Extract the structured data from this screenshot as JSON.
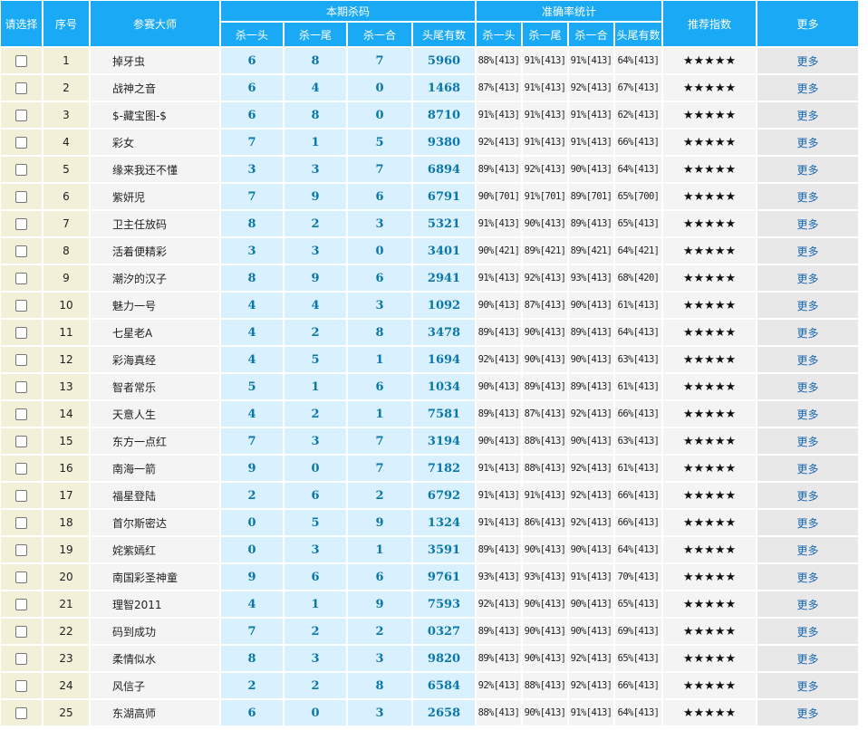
{
  "header": {
    "select": "请选择",
    "no": "序号",
    "master": "参赛大师",
    "kill_group": "本期杀码",
    "acc_group": "准确率统计",
    "recommend": "推荐指数",
    "more": "更多",
    "sub": [
      "杀一头",
      "杀一尾",
      "杀一合",
      "头尾有数",
      "杀一头",
      "杀一尾",
      "杀一合",
      "头尾有数"
    ]
  },
  "rating_stars": 5,
  "more_label": "更多",
  "rows": [
    {
      "no": "1",
      "name": "掉牙虫",
      "k": [
        "6",
        "8",
        "7",
        "5960"
      ],
      "a": [
        "88%[413]",
        "91%[413]",
        "91%[413]",
        "64%[413]"
      ]
    },
    {
      "no": "2",
      "name": "战神之音",
      "k": [
        "6",
        "4",
        "0",
        "1468"
      ],
      "a": [
        "87%[413]",
        "91%[413]",
        "92%[413]",
        "67%[413]"
      ]
    },
    {
      "no": "3",
      "name": "$-藏宝图-$",
      "k": [
        "6",
        "8",
        "0",
        "8710"
      ],
      "a": [
        "91%[413]",
        "91%[413]",
        "91%[413]",
        "62%[413]"
      ]
    },
    {
      "no": "4",
      "name": "彩女",
      "k": [
        "7",
        "1",
        "5",
        "9380"
      ],
      "a": [
        "92%[413]",
        "91%[413]",
        "91%[413]",
        "66%[413]"
      ]
    },
    {
      "no": "5",
      "name": "缘来我还不懂",
      "k": [
        "3",
        "3",
        "7",
        "6894"
      ],
      "a": [
        "89%[413]",
        "92%[413]",
        "90%[413]",
        "64%[413]"
      ]
    },
    {
      "no": "6",
      "name": "紫妍児",
      "k": [
        "7",
        "9",
        "6",
        "6791"
      ],
      "a": [
        "90%[701]",
        "91%[701]",
        "89%[701]",
        "65%[700]"
      ]
    },
    {
      "no": "7",
      "name": "卫主任放码",
      "k": [
        "8",
        "2",
        "3",
        "5321"
      ],
      "a": [
        "91%[413]",
        "90%[413]",
        "89%[413]",
        "65%[413]"
      ]
    },
    {
      "no": "8",
      "name": "活着便精彩",
      "k": [
        "3",
        "3",
        "0",
        "3401"
      ],
      "a": [
        "90%[421]",
        "89%[421]",
        "89%[421]",
        "64%[421]"
      ]
    },
    {
      "no": "9",
      "name": "潮汐的汉子",
      "k": [
        "8",
        "9",
        "6",
        "2941"
      ],
      "a": [
        "91%[413]",
        "92%[413]",
        "93%[413]",
        "68%[420]"
      ]
    },
    {
      "no": "10",
      "name": "魅力一号",
      "k": [
        "4",
        "4",
        "3",
        "1092"
      ],
      "a": [
        "90%[413]",
        "87%[413]",
        "90%[413]",
        "61%[413]"
      ]
    },
    {
      "no": "11",
      "name": "七星老A",
      "k": [
        "4",
        "2",
        "8",
        "3478"
      ],
      "a": [
        "89%[413]",
        "90%[413]",
        "89%[413]",
        "64%[413]"
      ]
    },
    {
      "no": "12",
      "name": "彩海真经",
      "k": [
        "4",
        "5",
        "1",
        "1694"
      ],
      "a": [
        "92%[413]",
        "90%[413]",
        "90%[413]",
        "63%[413]"
      ]
    },
    {
      "no": "13",
      "name": "智者常乐",
      "k": [
        "5",
        "1",
        "6",
        "1034"
      ],
      "a": [
        "90%[413]",
        "89%[413]",
        "89%[413]",
        "61%[413]"
      ]
    },
    {
      "no": "14",
      "name": "天意人生",
      "k": [
        "4",
        "2",
        "1",
        "7581"
      ],
      "a": [
        "89%[413]",
        "87%[413]",
        "92%[413]",
        "66%[413]"
      ]
    },
    {
      "no": "15",
      "name": "东方一点红",
      "k": [
        "7",
        "3",
        "7",
        "3194"
      ],
      "a": [
        "90%[413]",
        "88%[413]",
        "90%[413]",
        "63%[413]"
      ]
    },
    {
      "no": "16",
      "name": "南海一箭",
      "k": [
        "9",
        "0",
        "7",
        "7182"
      ],
      "a": [
        "91%[413]",
        "88%[413]",
        "92%[413]",
        "61%[413]"
      ]
    },
    {
      "no": "17",
      "name": "福星登陆",
      "k": [
        "2",
        "6",
        "2",
        "6792"
      ],
      "a": [
        "91%[413]",
        "91%[413]",
        "92%[413]",
        "66%[413]"
      ]
    },
    {
      "no": "18",
      "name": "首尔斯密达",
      "k": [
        "0",
        "5",
        "9",
        "1324"
      ],
      "a": [
        "91%[413]",
        "86%[413]",
        "92%[413]",
        "66%[413]"
      ]
    },
    {
      "no": "19",
      "name": "姹紫嫣红",
      "k": [
        "0",
        "3",
        "1",
        "3591"
      ],
      "a": [
        "89%[413]",
        "90%[413]",
        "90%[413]",
        "64%[413]"
      ]
    },
    {
      "no": "20",
      "name": "南国彩圣神童",
      "k": [
        "9",
        "6",
        "6",
        "9761"
      ],
      "a": [
        "93%[413]",
        "93%[413]",
        "91%[413]",
        "70%[413]"
      ]
    },
    {
      "no": "21",
      "name": "理智2011",
      "k": [
        "4",
        "1",
        "9",
        "7593"
      ],
      "a": [
        "92%[413]",
        "90%[413]",
        "90%[413]",
        "65%[413]"
      ]
    },
    {
      "no": "22",
      "name": "码到成功",
      "k": [
        "7",
        "2",
        "2",
        "0327"
      ],
      "a": [
        "89%[413]",
        "90%[413]",
        "90%[413]",
        "69%[413]"
      ]
    },
    {
      "no": "23",
      "name": "柔情似水",
      "k": [
        "8",
        "3",
        "3",
        "9820"
      ],
      "a": [
        "89%[413]",
        "90%[413]",
        "92%[413]",
        "65%[413]"
      ]
    },
    {
      "no": "24",
      "name": "风信子",
      "k": [
        "2",
        "2",
        "8",
        "6584"
      ],
      "a": [
        "92%[413]",
        "88%[413]",
        "92%[413]",
        "66%[413]"
      ]
    },
    {
      "no": "25",
      "name": "东湖高师",
      "k": [
        "6",
        "0",
        "3",
        "2658"
      ],
      "a": [
        "88%[413]",
        "90%[413]",
        "91%[413]",
        "64%[413]"
      ]
    }
  ]
}
